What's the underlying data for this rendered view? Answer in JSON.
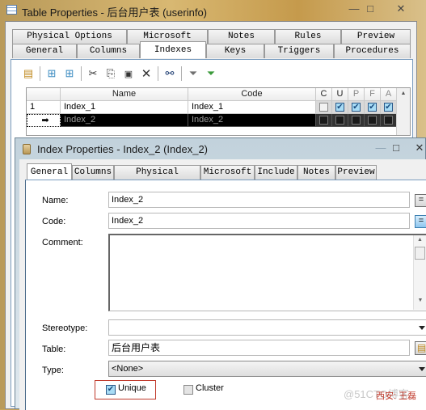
{
  "outer_window": {
    "title": "Table Properties - 后台用户表 (userinfo)",
    "controls": {
      "minimize": "—",
      "maximize": "□",
      "close": "✕"
    },
    "tabs_top": [
      "Physical Options",
      "Microsoft",
      "Notes",
      "Rules",
      "Preview"
    ],
    "tabs_bottom": [
      "General",
      "Columns",
      "Indexes",
      "Keys",
      "Triggers",
      "Procedures"
    ],
    "active_tab": "Indexes",
    "toolbar": [
      {
        "name": "properties-icon",
        "glyph": "▤"
      },
      {
        "name": "insert-row-icon",
        "glyph": "⊞"
      },
      {
        "name": "add-row-icon",
        "glyph": "⊞"
      },
      {
        "name": "cut-icon",
        "glyph": "✂"
      },
      {
        "name": "copy-icon",
        "glyph": "⎘"
      },
      {
        "name": "paste-icon",
        "glyph": "📋"
      },
      {
        "name": "delete-icon",
        "glyph": "✕"
      },
      {
        "name": "find-icon",
        "glyph": "⚲"
      },
      {
        "name": "filter-edit-icon",
        "glyph": "⏷"
      },
      {
        "name": "filter-apply-icon",
        "glyph": "⏷"
      }
    ],
    "grid": {
      "columns": [
        "",
        "Name",
        "Code",
        "C",
        "U",
        "P",
        "F",
        "A"
      ],
      "rows": [
        {
          "marker": "1",
          "name": "Index_1",
          "code": "Index_1",
          "C": false,
          "U": true,
          "P": true,
          "F": true,
          "A": true,
          "selected": false
        },
        {
          "marker": "➡",
          "name": "Index_2",
          "code": "Index_2",
          "C": false,
          "U": false,
          "P": false,
          "F": false,
          "A": false,
          "selected": true
        }
      ]
    }
  },
  "inner_dialog": {
    "title": "Index Properties - Index_2 (Index_2)",
    "controls": {
      "minimize": "—",
      "maximize": "□",
      "close": "✕"
    },
    "tabs": [
      "General",
      "Columns",
      "Physical Options",
      "Microsoft",
      "Include",
      "Notes",
      "Preview"
    ],
    "active_tab": "General",
    "form": {
      "name_label": "Name:",
      "name_value": "Index_2",
      "code_label": "Code:",
      "code_value": "Index_2",
      "comment_label": "Comment:",
      "comment_value": "",
      "stereotype_label": "Stereotype:",
      "stereotype_value": "",
      "table_label": "Table:",
      "table_value": "后台用户表",
      "type_label": "Type:",
      "type_value": "<None>",
      "unique_label": "Unique",
      "unique_checked": true,
      "cluster_label": "Cluster",
      "cluster_checked": false,
      "equal_button": "="
    }
  },
  "watermark": {
    "text": "@51CTO博客",
    "signature": "西安: 王磊"
  },
  "colors": {
    "highlight_border": "#c0392b",
    "selected_row": "#000000",
    "check_fill": "#a8dcf5"
  }
}
